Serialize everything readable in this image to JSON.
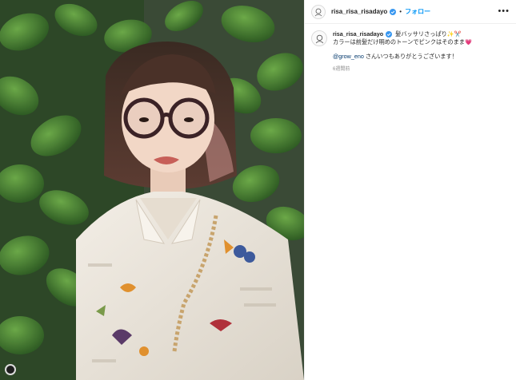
{
  "post": {
    "username": "risa_risa_risadayo",
    "follow_label": "フォロー",
    "dot_separator": "•",
    "more_label": "•••",
    "caption": {
      "line1": "髪バッサリさっぱり✨✂️",
      "line2": "カラーは前髪だけ明めのトーンでピンクはそのまま💗",
      "mention": "@grow_eno",
      "mention_suffix": " さんいつもありがとうございます！"
    },
    "timestamp": "6週間前"
  },
  "colors": {
    "accent": "#0095f6",
    "verified": "#3897f0",
    "link": "#00376b",
    "muted": "#8e8e8e"
  },
  "icons": {
    "verified": "verified-badge-icon",
    "more": "more-options-icon",
    "carousel": "carousel-indicator-icon"
  }
}
